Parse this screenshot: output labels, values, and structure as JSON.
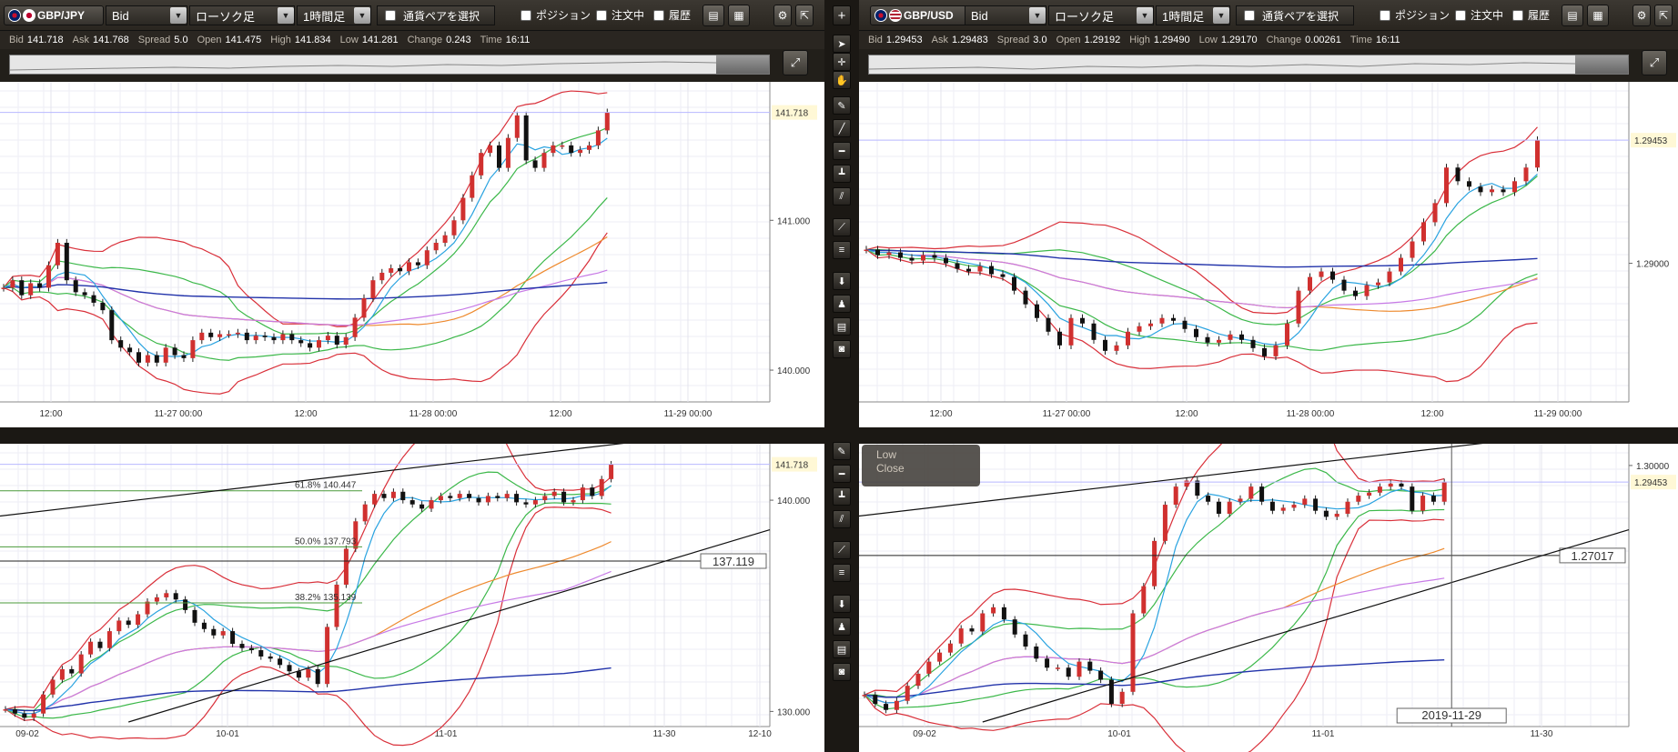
{
  "toolbar_common": {
    "price_type": "Bid",
    "chart_type": "ローソク足",
    "timeframe": "1時間足",
    "pair_select": "通貨ペアを選択",
    "position": "ポジション",
    "orders": "注文中",
    "history": "履歴",
    "add_icon": "+"
  },
  "left": {
    "pair": "GBP/JPY",
    "quote": {
      "bid_l": "Bid",
      "bid": "141.718",
      "ask_l": "Ask",
      "ask": "141.768",
      "spread_l": "Spread",
      "spread": "5.0",
      "open_l": "Open",
      "open": "141.475",
      "high_l": "High",
      "high": "141.834",
      "low_l": "Low",
      "low": "141.281",
      "change_l": "Change",
      "change": "0.243",
      "time_l": "Time",
      "time": "16:11"
    }
  },
  "right": {
    "pair": "GBP/USD",
    "quote": {
      "bid_l": "Bid",
      "bid": "1.29453",
      "ask_l": "Ask",
      "ask": "1.29483",
      "spread_l": "Spread",
      "spread": "3.0",
      "open_l": "Open",
      "open": "1.29192",
      "high_l": "High",
      "high": "1.29490",
      "low_l": "Low",
      "low": "1.29170",
      "change_l": "Change",
      "change": "0.00261",
      "time_l": "Time",
      "time": "16:11"
    }
  },
  "bottom_right_tooltip": {
    "low": "Low",
    "close": "Close"
  },
  "chart_data": [
    {
      "type": "candlestick",
      "name": "GBP/JPY 1H",
      "ylim": [
        139.8,
        141.9
      ],
      "yticks": [
        "141.000",
        "140.000"
      ],
      "current_price": "141.718",
      "xticks": [
        "12:00",
        "11-27 00:00",
        "12:00",
        "11-28 00:00",
        "12:00",
        "11-29 00:00"
      ],
      "closes": [
        140.55,
        140.6,
        140.5,
        140.58,
        140.55,
        140.7,
        140.85,
        140.6,
        140.52,
        140.5,
        140.45,
        140.4,
        140.2,
        140.15,
        140.12,
        140.05,
        140.1,
        140.05,
        140.15,
        140.1,
        140.08,
        140.2,
        140.25,
        140.22,
        140.24,
        140.24,
        140.25,
        140.2,
        140.23,
        140.22,
        140.2,
        140.24,
        140.2,
        140.18,
        140.15,
        140.2,
        140.23,
        140.17,
        140.22,
        140.35,
        140.48,
        140.6,
        140.65,
        140.68,
        140.66,
        140.72,
        140.7,
        140.8,
        140.85,
        140.9,
        141.0,
        141.15,
        141.3,
        141.45,
        141.5,
        141.35,
        141.55,
        141.7,
        141.4,
        141.35,
        141.45,
        141.5,
        141.5,
        141.45,
        141.47,
        141.5,
        141.6,
        141.72
      ]
    },
    {
      "type": "candlestick",
      "name": "GBP/USD 1H",
      "ylim": [
        1.285,
        1.2965
      ],
      "yticks": [
        "1.29000"
      ],
      "current_price": "1.29453",
      "xticks": [
        "12:00",
        "11-27 00:00",
        "12:00",
        "11-28 00:00",
        "12:00",
        "11-29 00:00"
      ],
      "closes": [
        1.2905,
        1.2903,
        1.2904,
        1.2902,
        1.2901,
        1.2903,
        1.2902,
        1.29,
        1.2898,
        1.2897,
        1.2899,
        1.2896,
        1.2895,
        1.289,
        1.2885,
        1.288,
        1.2875,
        1.287,
        1.288,
        1.2878,
        1.2872,
        1.2868,
        1.287,
        1.2875,
        1.2877,
        1.2878,
        1.288,
        1.2879,
        1.2876,
        1.2873,
        1.2871,
        1.2872,
        1.2874,
        1.2872,
        1.2869,
        1.2866,
        1.287,
        1.2878,
        1.289,
        1.2895,
        1.2897,
        1.2894,
        1.289,
        1.2888,
        1.2892,
        1.2893,
        1.2897,
        1.2902,
        1.2908,
        1.2915,
        1.2922,
        1.2935,
        1.293,
        1.2928,
        1.2926,
        1.2927,
        1.2926,
        1.293,
        1.2935,
        1.2945
      ]
    },
    {
      "type": "candlestick",
      "name": "GBP/JPY Daily",
      "ylim": [
        129.5,
        142.5
      ],
      "yticks": [
        "140.000",
        "130.000"
      ],
      "current_price": "141.718",
      "hline_label": "137.119",
      "fibo": [
        {
          "label": "61.8%  140.447"
        },
        {
          "label": "50.0%  137.793"
        },
        {
          "label": "38.2%  135.139"
        }
      ],
      "xticks": [
        "09-02",
        "10-01",
        "11-01",
        "11-30",
        "12-10"
      ],
      "closes": [
        130.1,
        129.9,
        129.7,
        129.9,
        130.8,
        131.5,
        132.0,
        131.8,
        132.7,
        133.3,
        133.0,
        133.8,
        134.3,
        134.1,
        134.6,
        135.2,
        135.4,
        135.6,
        135.3,
        134.8,
        134.2,
        133.9,
        133.6,
        133.8,
        133.2,
        133.0,
        132.9,
        132.6,
        132.5,
        132.2,
        131.9,
        131.6,
        132.0,
        131.3,
        134.0,
        136.0,
        137.7,
        139.0,
        139.8,
        140.3,
        140.1,
        140.4,
        140.0,
        139.8,
        139.6,
        140.0,
        140.2,
        140.1,
        140.3,
        140.1,
        139.9,
        140.2,
        140.1,
        140.3,
        139.9,
        139.8,
        140.0,
        140.2,
        140.4,
        139.9,
        140.0,
        140.6,
        140.2,
        141.0,
        141.7
      ]
    },
    {
      "type": "candlestick",
      "name": "GBP/USD Daily",
      "ylim": [
        1.215,
        1.306
      ],
      "yticks": [
        "1.30000"
      ],
      "current_price": "1.29453",
      "hline_label": "1.27017",
      "date_label": "2019-11-29",
      "xticks": [
        "09-02",
        "10-01",
        "11-01",
        "11-30"
      ],
      "closes": [
        1.224,
        1.221,
        1.219,
        1.222,
        1.227,
        1.231,
        1.235,
        1.238,
        1.241,
        1.246,
        1.245,
        1.251,
        1.253,
        1.249,
        1.244,
        1.24,
        1.236,
        1.233,
        1.233,
        1.23,
        1.235,
        1.232,
        1.229,
        1.221,
        1.225,
        1.251,
        1.26,
        1.275,
        1.287,
        1.293,
        1.295,
        1.29,
        1.288,
        1.284,
        1.288,
        1.289,
        1.293,
        1.288,
        1.285,
        1.286,
        1.287,
        1.289,
        1.285,
        1.283,
        1.284,
        1.288,
        1.29,
        1.291,
        1.293,
        1.294,
        1.293,
        1.285,
        1.29,
        1.288,
        1.2945
      ]
    }
  ]
}
